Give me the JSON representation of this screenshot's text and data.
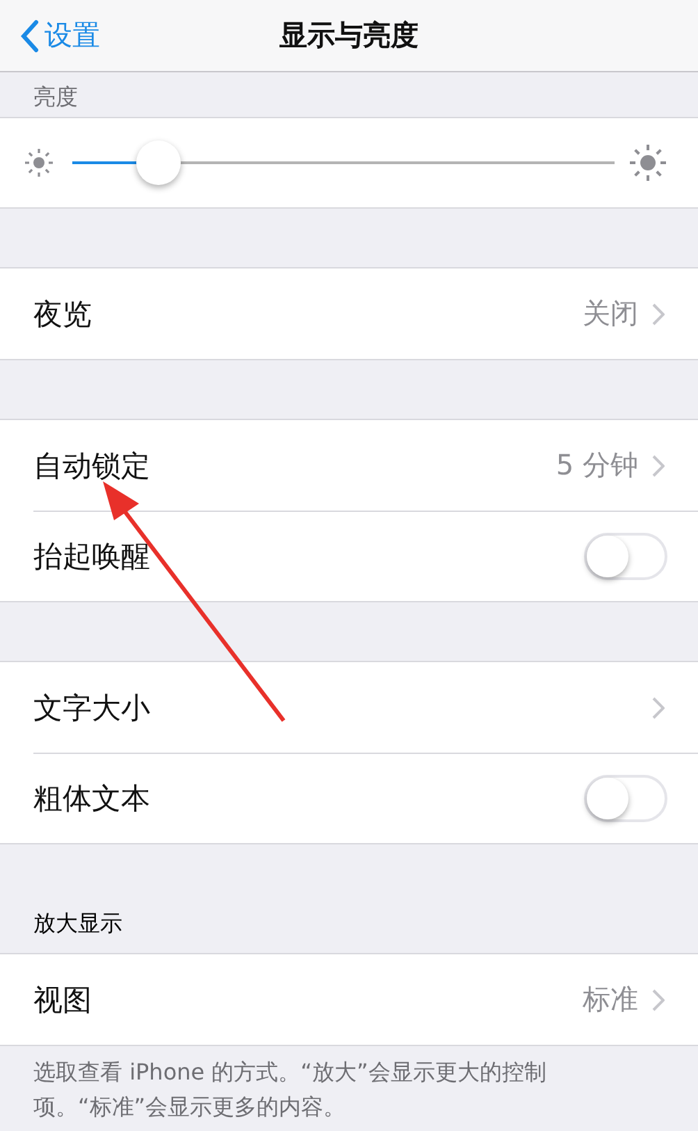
{
  "nav": {
    "back": "设置",
    "title": "显示与亮度"
  },
  "sections": [
    {
      "header": "亮度",
      "rows": [
        {
          "kind": "slider",
          "level": 0.16
        }
      ]
    },
    {
      "rows": [
        {
          "kind": "link",
          "label": "夜览",
          "value": "关闭"
        }
      ]
    },
    {
      "rows": [
        {
          "kind": "link",
          "label": "自动锁定",
          "value": "5 分钟"
        },
        {
          "kind": "switch",
          "label": "抬起唤醒",
          "on": false
        }
      ]
    },
    {
      "rows": [
        {
          "kind": "link",
          "label": "文字大小"
        },
        {
          "kind": "switch",
          "label": "粗体文本",
          "on": false
        }
      ]
    },
    {
      "header": "放大显示",
      "rows": [
        {
          "kind": "link",
          "label": "视图",
          "value": "标准"
        }
      ],
      "footer": "选取查看 iPhone 的方式。“放大”会显示更大的控制项。“标准”会显示更多的内容。"
    }
  ],
  "annotations": [
    {
      "kind": "arrow"
    }
  ]
}
